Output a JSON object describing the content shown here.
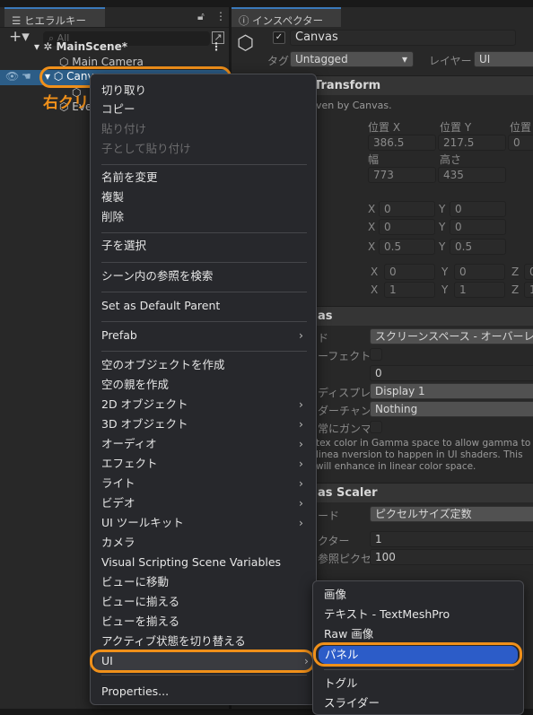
{
  "hierarchy": {
    "tab_label": "ヒエラルキー",
    "search_placeholder": "All",
    "scene": "MainScene*",
    "items": [
      "Main Camera",
      "Canvas",
      "EventSystem"
    ]
  },
  "annotation": {
    "right_click": "右クリック"
  },
  "inspector": {
    "tab_label": "インスペクター",
    "object_name": "Canvas",
    "tag_label": "タグ",
    "tag_value": "Untagged",
    "layer_label": "レイヤー",
    "layer_value": "UI",
    "rect_transform": {
      "title": "Transform",
      "note": "ven by Canvas.",
      "pos_x_label": "位置 X",
      "pos_y_label": "位置 Y",
      "pos_z_label": "位置",
      "pos_x": "386.5",
      "pos_y": "217.5",
      "pos_z": "0",
      "width_label": "幅",
      "height_label": "高さ",
      "width": "773",
      "height": "435",
      "anchor_min": {
        "x": "0",
        "y": "0"
      },
      "anchor_max": {
        "x": "0",
        "y": "0"
      },
      "pivot": {
        "x": "0.5",
        "y": "0.5"
      },
      "rotation": {
        "x": "0",
        "y": "0",
        "z": "0"
      },
      "scale": {
        "x": "1",
        "y": "1",
        "z": "1"
      },
      "x": "X",
      "y": "Y",
      "z": "Z"
    },
    "canvas": {
      "title": "as",
      "render_mode_label": "ド",
      "render_mode": "スクリーンスペース - オーバーレ",
      "pixel_perfect_label": "ーフェクト",
      "sort_order": "0",
      "target_display_label": "ディスプレ",
      "target_display": "Display 1",
      "shader_channels_label": "ダーチャン:",
      "shader_channels": "Nothing",
      "gamma_label": "常にガンマ1",
      "gamma_help": "tex color in Gamma space to allow gamma to linea nversion to happen in UI shaders. This will enhance in linear color space."
    },
    "canvas_scaler": {
      "title": "as Scaler",
      "mode_label": "ード",
      "mode": "ピクセルサイズ定数",
      "factor_label": "クター",
      "factor": "1",
      "ref_pixels_label": "参照ピクセル",
      "ref_pixels": "100"
    }
  },
  "context_menu": {
    "items": [
      {
        "label": "切り取り"
      },
      {
        "label": "コピー"
      },
      {
        "label": "貼り付け",
        "disabled": true
      },
      {
        "label": "子として貼り付け",
        "disabled": true
      },
      {
        "label": "名前を変更"
      },
      {
        "label": "複製"
      },
      {
        "label": "削除"
      },
      {
        "label": "子を選択"
      },
      {
        "label": "シーン内の参照を検索"
      },
      {
        "label": "Set as Default Parent"
      },
      {
        "label": "Prefab",
        "submenu": true
      },
      {
        "label": "空のオブジェクトを作成"
      },
      {
        "label": "空の親を作成"
      },
      {
        "label": "2D オブジェクト",
        "submenu": true
      },
      {
        "label": "3D オブジェクト",
        "submenu": true
      },
      {
        "label": "オーディオ",
        "submenu": true
      },
      {
        "label": "エフェクト",
        "submenu": true
      },
      {
        "label": "ライト",
        "submenu": true
      },
      {
        "label": "ビデオ",
        "submenu": true
      },
      {
        "label": "UI ツールキット",
        "submenu": true
      },
      {
        "label": "カメラ"
      },
      {
        "label": "Visual Scripting Scene Variables"
      },
      {
        "label": "ビューに移動"
      },
      {
        "label": "ビューに揃える"
      },
      {
        "label": "ビューを揃える"
      },
      {
        "label": "アクティブ状態を切り替える"
      },
      {
        "label": "UI",
        "submenu": true
      },
      {
        "label": "Properties..."
      }
    ]
  },
  "ui_submenu": {
    "items": [
      "画像",
      "テキスト - TextMeshPro",
      "Raw 画像",
      "パネル",
      "トグル",
      "スライダー"
    ],
    "selected": "パネル"
  },
  "colors": {
    "highlight": "#f0901a",
    "selection": "#2c5cc8",
    "hierarchy_selection": "#2c5d87"
  }
}
